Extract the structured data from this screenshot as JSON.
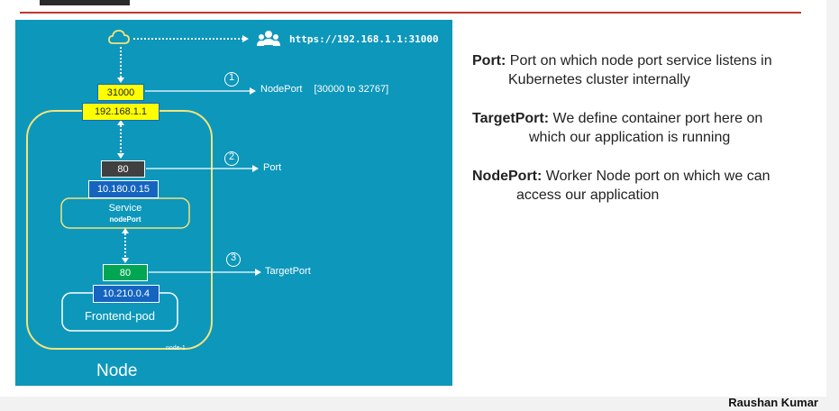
{
  "diagram": {
    "url": "https://192.168.1.1:31000",
    "node_port_value": "31000",
    "node_ip": "192.168.1.1",
    "service_port": "80",
    "service_ip": "10.180.0.15",
    "service_label": "Service",
    "service_sublabel": "nodePort",
    "target_port": "80",
    "pod_ip": "10.210.0.4",
    "pod_label": "Frontend-pod",
    "node_small_label": "node-1",
    "node_label": "Node",
    "steps": [
      "1",
      "2",
      "3"
    ],
    "nodeport_label": "NodePort",
    "nodeport_range": "[30000 to 32767]",
    "port_label": "Port",
    "targetport_label": "TargetPort",
    "icons": [
      "cloud-icon",
      "users-icon"
    ],
    "colors": {
      "background": "#0d97bb",
      "yellow": "#ffff00",
      "green": "#00a651",
      "dark": "#404040",
      "blue": "#1565c0",
      "outline": "#f4e47a"
    }
  },
  "definitions": [
    {
      "term": "Port:",
      "line1": "Port on which node port service listens in",
      "line2": "Kubernetes cluster internally"
    },
    {
      "term": "TargetPort:",
      "line1": "We define container port here on",
      "line2": "which our application is running"
    },
    {
      "term": "NodePort:",
      "line1": "Worker Node port on which we can",
      "line2": "access our application"
    }
  ],
  "author": "Raushan Kumar"
}
